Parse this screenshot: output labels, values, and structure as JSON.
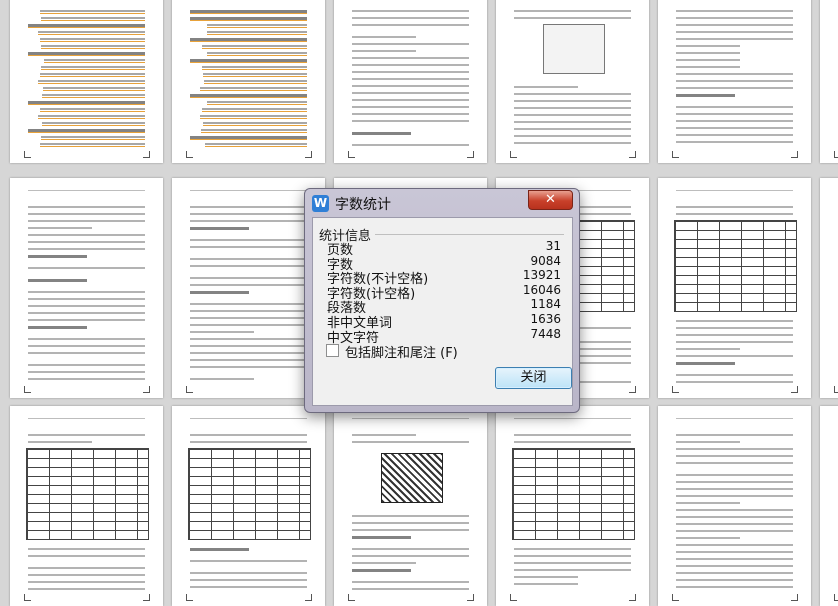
{
  "dialog": {
    "title": "字数统计",
    "close_glyph": "✕",
    "app_icon_glyph": "W",
    "section_title": "统计信息",
    "stats": [
      {
        "label": "页数",
        "value": "31"
      },
      {
        "label": "字数",
        "value": "9084"
      },
      {
        "label": "字符数(不计空格)",
        "value": "13921"
      },
      {
        "label": "字符数(计空格)",
        "value": "16046"
      },
      {
        "label": "段落数",
        "value": "1184"
      },
      {
        "label": "非中文单词",
        "value": "1636"
      },
      {
        "label": "中文字符",
        "value": "7448"
      }
    ],
    "checkbox": {
      "label": "包括脚注和尾注 (F)",
      "checked": false
    },
    "close_button_label": "关闭"
  },
  "colors": {
    "background": "#d6d6d6",
    "dialog_frame": "#c9c6d6",
    "close_red": "#c8402a",
    "button_blue": "#bde3f7",
    "icon_blue": "#2f7fd6",
    "toc_highlight": "#e8a23a"
  },
  "icons": {
    "app": "wps-writer-icon",
    "close": "close-icon",
    "checkbox": "checkbox-icon"
  }
}
